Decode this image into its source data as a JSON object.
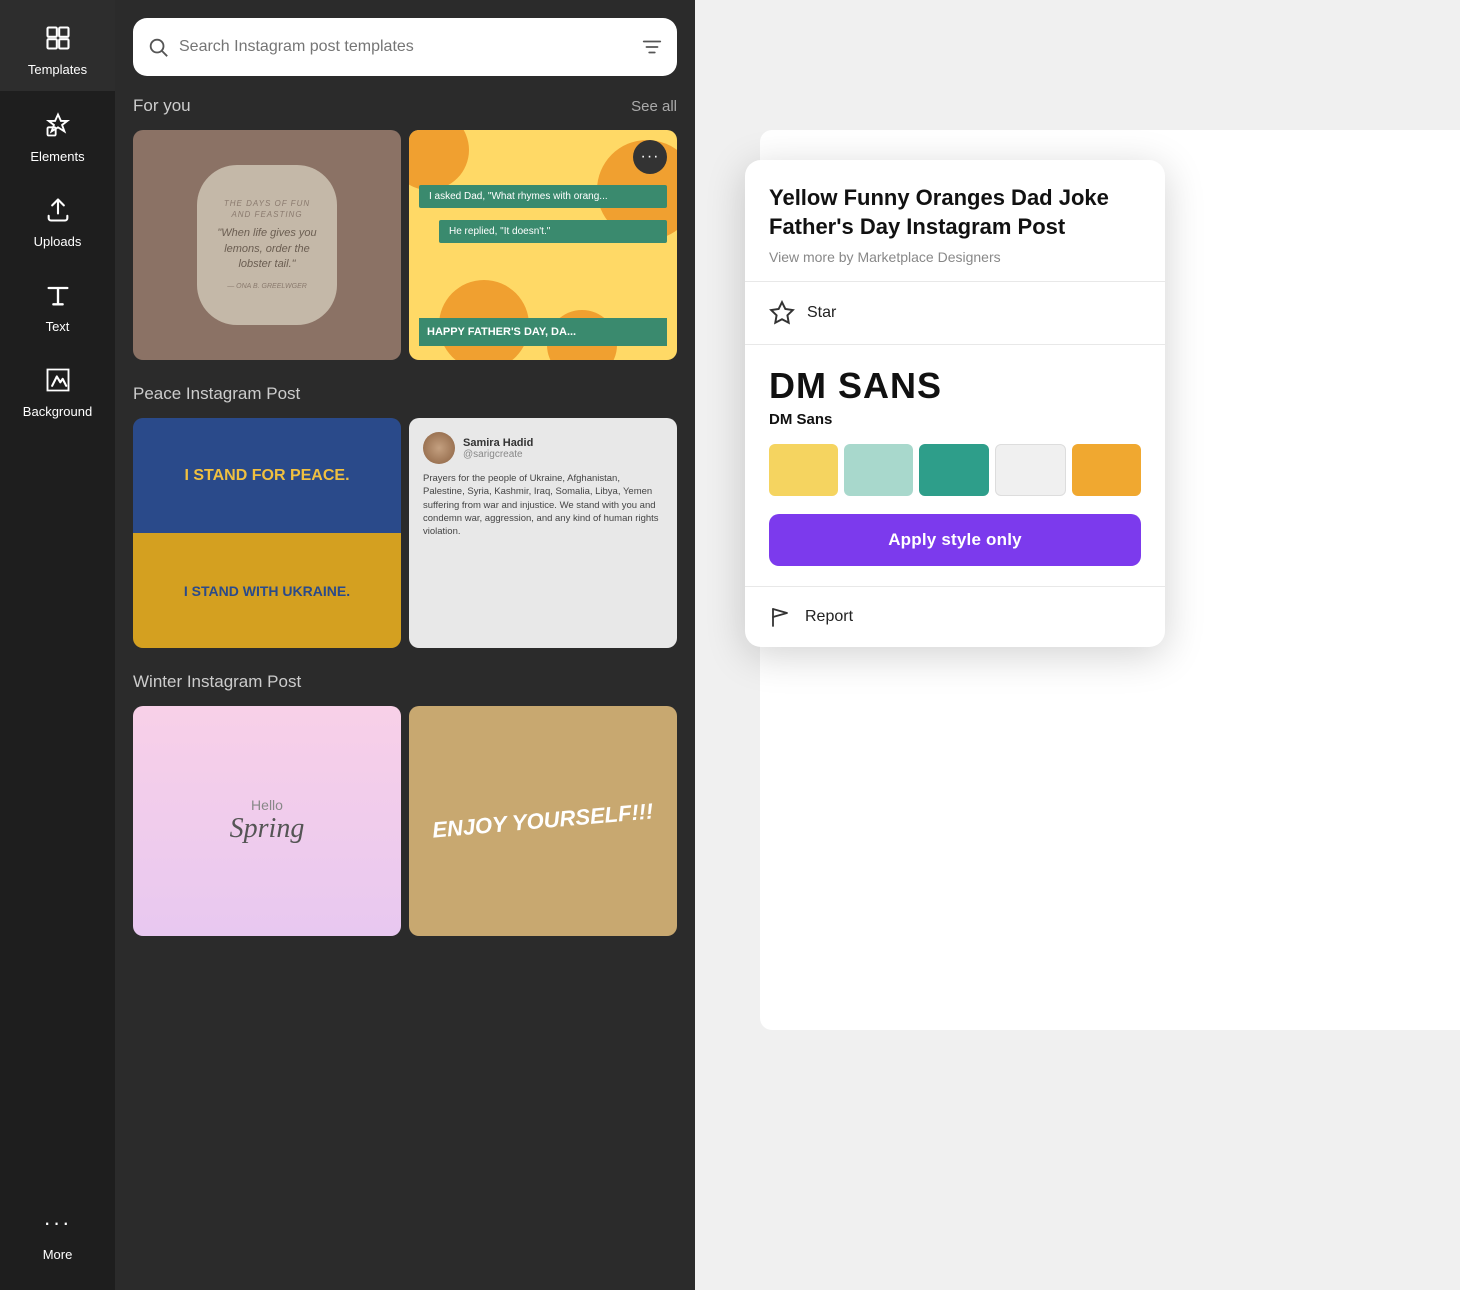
{
  "sidebar": {
    "items": [
      {
        "label": "Templates",
        "icon": "grid-icon"
      },
      {
        "label": "Elements",
        "icon": "elements-icon"
      },
      {
        "label": "Uploads",
        "icon": "upload-icon"
      },
      {
        "label": "Text",
        "icon": "text-icon"
      },
      {
        "label": "Background",
        "icon": "background-icon"
      },
      {
        "label": "More",
        "icon": "more-icon"
      }
    ]
  },
  "search": {
    "placeholder": "Search Instagram post templates"
  },
  "sections": [
    {
      "title": "For you",
      "see_all": "See all"
    },
    {
      "title": "Peace Instagram Post",
      "see_all": ""
    },
    {
      "title": "Winter Instagram Post",
      "see_all": ""
    }
  ],
  "templates": {
    "t1": {
      "quote": "\"When life gives you lemons, order the lobster tail.\""
    },
    "t2": {
      "line1": "I asked Dad, \"What rhymes with orang...",
      "line2": "He replied, \"It doesn't.\"",
      "footer": "HAPPY FATHER'S DAY, DA..."
    },
    "t3_top": "I STAND FOR PEACE.",
    "t3_bottom": "I STAND WITH UKRAINE.",
    "t4": {
      "name": "Samira Hadid",
      "handle": "@sarigcreate",
      "body": "Prayers for the people of Ukraine, Afghanistan, Palestine, Syria, Kashmir, Iraq, Somalia, Libya, Yemen suffering from war and injustice. We stand with you and condemn war, aggression, and any kind of human rights violation."
    },
    "t5": {
      "hello": "Hello",
      "spring": "Spring"
    },
    "t6": {
      "text": "ENJOY YOURSELF!!!"
    }
  },
  "popup": {
    "title": "Yellow Funny Oranges Dad Joke Father's Day Instagram Post",
    "subtitle": "View more by Marketplace Designers",
    "star_label": "Star",
    "font_preview": "DM SANS",
    "font_name": "DM Sans",
    "colors": [
      {
        "hex": "#f5d460"
      },
      {
        "hex": "#a8d8cc"
      },
      {
        "hex": "#2e9e8a"
      },
      {
        "hex": "#f0f0f0"
      },
      {
        "hex": "#f0a830"
      }
    ],
    "apply_label": "Apply style only",
    "report_label": "Report"
  }
}
